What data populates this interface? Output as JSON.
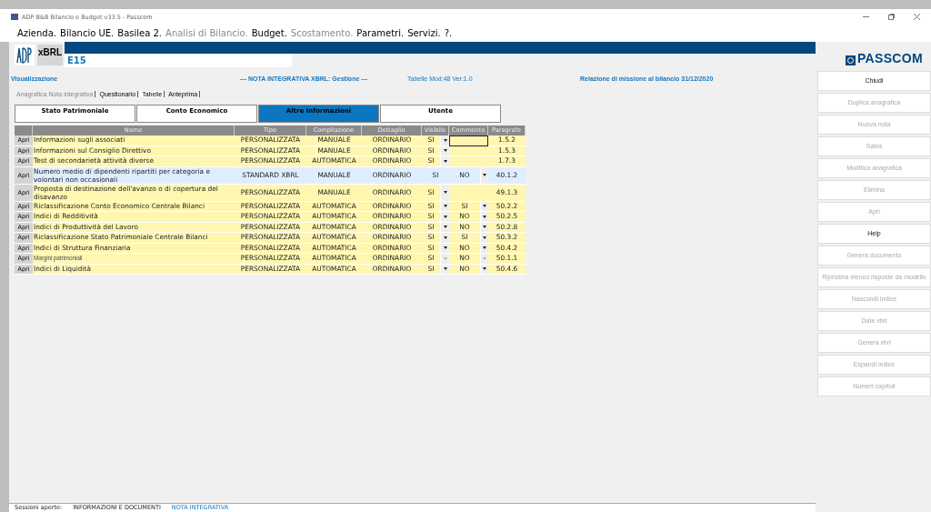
{
  "window": {
    "title": "ADP B&B Bilancio e Budget v33.5 - Passcom"
  },
  "menu": [
    {
      "label": "Azienda.",
      "disabled": false
    },
    {
      "label": "Bilancio UE.",
      "disabled": false
    },
    {
      "label": "Basilea 2.",
      "disabled": false
    },
    {
      "label": "Analisi di Bilancio.",
      "disabled": true
    },
    {
      "label": "Budget.",
      "disabled": false
    },
    {
      "label": "Scostamento.",
      "disabled": true
    },
    {
      "label": "Parametri.",
      "disabled": false
    },
    {
      "label": "Servizi.",
      "disabled": false
    },
    {
      "label": "?.",
      "disabled": false
    }
  ],
  "header": {
    "logo_text": "xBRL",
    "code": "E15",
    "mode": "Visualizzazione",
    "title": "--- NOTA INTEGRATIVA XBRL: Gestione ---",
    "model": "Tabelle Mod:48  Ver:1.0",
    "report": "Relazione di missione al bilancio 31/12/2020",
    "brand": "PASSCOM"
  },
  "subtabs": [
    {
      "label": "Anagrafica Nota integrativa",
      "selected": false,
      "disabled": true
    },
    {
      "label": "Questionario",
      "selected": false,
      "disabled": false
    },
    {
      "label": "Tabelle",
      "selected": true,
      "disabled": false
    },
    {
      "label": "Anteprima",
      "selected": false,
      "disabled": false
    }
  ],
  "tabs": [
    {
      "label": "Stato Patrimoniale",
      "selected": false
    },
    {
      "label": "Conto Economico",
      "selected": false
    },
    {
      "label": "Altre Informazioni",
      "selected": true
    },
    {
      "label": "Utente",
      "selected": false
    }
  ],
  "table": {
    "columns": [
      "Nome",
      "Tipo",
      "Compilazione",
      "Dettaglio",
      "Visibile",
      "Commento",
      "Paragrafo"
    ],
    "rows": [
      {
        "open": "Apri",
        "name": "Informazioni sugli associati",
        "tipo": "PERSONALIZZATA",
        "compilazione": "MANUALE",
        "dettaglio": "ORDINARIO",
        "visibile": "SI",
        "visibile_dropdown": true,
        "commento": "",
        "commento_dropdown": false,
        "commento_focused": true,
        "paragrafo": "1.5.2",
        "selected": false,
        "disabled": false
      },
      {
        "open": "Apri",
        "name": "Informazioni sul Consiglio Direttivo",
        "tipo": "PERSONALIZZATA",
        "compilazione": "MANUALE",
        "dettaglio": "ORDINARIO",
        "visibile": "SI",
        "visibile_dropdown": true,
        "commento": "",
        "commento_dropdown": false,
        "commento_focused": false,
        "paragrafo": "1.5.3",
        "selected": false,
        "disabled": false
      },
      {
        "open": "Apri",
        "name": "Test di secondarietà attività diverse",
        "tipo": "PERSONALIZZATA",
        "compilazione": "AUTOMATICA",
        "dettaglio": "ORDINARIO",
        "visibile": "SI",
        "visibile_dropdown": true,
        "commento": "",
        "commento_dropdown": false,
        "commento_focused": false,
        "paragrafo": "1.7.3",
        "selected": false,
        "disabled": false
      },
      {
        "open": "Apri",
        "name": "Numero medio di dipendenti ripartiti per categoria e volontari non occasionali",
        "tipo": "STANDARD XBRL",
        "compilazione": "MANUALE",
        "dettaglio": "ORDINARIO",
        "visibile": "SI",
        "visibile_dropdown": false,
        "commento": "NO",
        "commento_dropdown": true,
        "commento_focused": false,
        "paragrafo": "40.1.2",
        "selected": true,
        "disabled": false
      },
      {
        "open": "Apri",
        "name": "Proposta di destinazione dell'avanzo o di copertura del disavanzo",
        "tipo": "PERSONALIZZATA",
        "compilazione": "MANUALE",
        "dettaglio": "ORDINARIO",
        "visibile": "SI",
        "visibile_dropdown": true,
        "commento": "",
        "commento_dropdown": false,
        "commento_focused": false,
        "paragrafo": "49.1.3",
        "selected": false,
        "disabled": false
      },
      {
        "open": "Apri",
        "name": "Riclassificazione Conto Economico Centrale Bilanci",
        "tipo": "PERSONALIZZATA",
        "compilazione": "AUTOMATICA",
        "dettaglio": "ORDINARIO",
        "visibile": "SI",
        "visibile_dropdown": true,
        "commento": "SI",
        "commento_dropdown": true,
        "commento_focused": false,
        "paragrafo": "50.2.2",
        "selected": false,
        "disabled": false
      },
      {
        "open": "Apri",
        "name": "Indici di Redditività",
        "tipo": "PERSONALIZZATA",
        "compilazione": "AUTOMATICA",
        "dettaglio": "ORDINARIO",
        "visibile": "SI",
        "visibile_dropdown": true,
        "commento": "NO",
        "commento_dropdown": true,
        "commento_focused": false,
        "paragrafo": "50.2.5",
        "selected": false,
        "disabled": false
      },
      {
        "open": "Apri",
        "name": "Indici di Produttività del Lavoro",
        "tipo": "PERSONALIZZATA",
        "compilazione": "AUTOMATICA",
        "dettaglio": "ORDINARIO",
        "visibile": "SI",
        "visibile_dropdown": true,
        "commento": "NO",
        "commento_dropdown": true,
        "commento_focused": false,
        "paragrafo": "50.2.8",
        "selected": false,
        "disabled": false
      },
      {
        "open": "Apri",
        "name": "Riclassificazione Stato Patrimoniale Centrale Bilanci",
        "tipo": "PERSONALIZZATA",
        "compilazione": "AUTOMATICA",
        "dettaglio": "ORDINARIO",
        "visibile": "SI",
        "visibile_dropdown": true,
        "commento": "SI",
        "commento_dropdown": true,
        "commento_focused": false,
        "paragrafo": "50.3.2",
        "selected": false,
        "disabled": false
      },
      {
        "open": "Apri",
        "name": "Indici di Struttura Finanziaria",
        "tipo": "PERSONALIZZATA",
        "compilazione": "AUTOMATICA",
        "dettaglio": "ORDINARIO",
        "visibile": "SI",
        "visibile_dropdown": true,
        "commento": "NO",
        "commento_dropdown": true,
        "commento_focused": false,
        "paragrafo": "50.4.2",
        "selected": false,
        "disabled": false
      },
      {
        "open": "Apri",
        "name": "Margini patrimoniali",
        "tipo": "PERSONALIZZATA",
        "compilazione": "AUTOMATICA",
        "dettaglio": "ORDINARIO",
        "visibile": "SI",
        "visibile_dropdown": true,
        "commento": "NO",
        "commento_dropdown": true,
        "commento_focused": false,
        "paragrafo": "50.1.1",
        "selected": false,
        "disabled": true
      },
      {
        "open": "Apri",
        "name": "Indici di Liquidità",
        "tipo": "PERSONALIZZATA",
        "compilazione": "AUTOMATICA",
        "dettaglio": "ORDINARIO",
        "visibile": "SI",
        "visibile_dropdown": true,
        "commento": "NO",
        "commento_dropdown": true,
        "commento_focused": false,
        "paragrafo": "50.4.6",
        "selected": false,
        "disabled": false
      }
    ]
  },
  "actions": [
    {
      "label": "Chiudi",
      "disabled": false
    },
    {
      "label": "Duplica anagrafica",
      "disabled": true
    },
    {
      "label": "Nuova nota",
      "disabled": true
    },
    {
      "label": "Salva",
      "disabled": true
    },
    {
      "label": "Modifica anagrafica",
      "disabled": true
    },
    {
      "label": "Elimina",
      "disabled": true
    },
    {
      "label": "Apri",
      "disabled": true
    },
    {
      "label": "Help",
      "disabled": false
    },
    {
      "label": "Genera documento",
      "disabled": true
    },
    {
      "label": "Ripristina elenco risposte da modello",
      "disabled": true
    },
    {
      "label": "Nascondi indice",
      "disabled": true
    },
    {
      "label": "Date xbrl",
      "disabled": true
    },
    {
      "label": "Genera xbrl",
      "disabled": true
    },
    {
      "label": "Espandi indice",
      "disabled": true
    },
    {
      "label": "Numeri capitoli",
      "disabled": true
    }
  ],
  "status_bar": {
    "label": "Sessioni aperte:",
    "session": "INFORMAZIONI E DOCUMENTI",
    "link": "NOTA INTEGRATIVA"
  }
}
